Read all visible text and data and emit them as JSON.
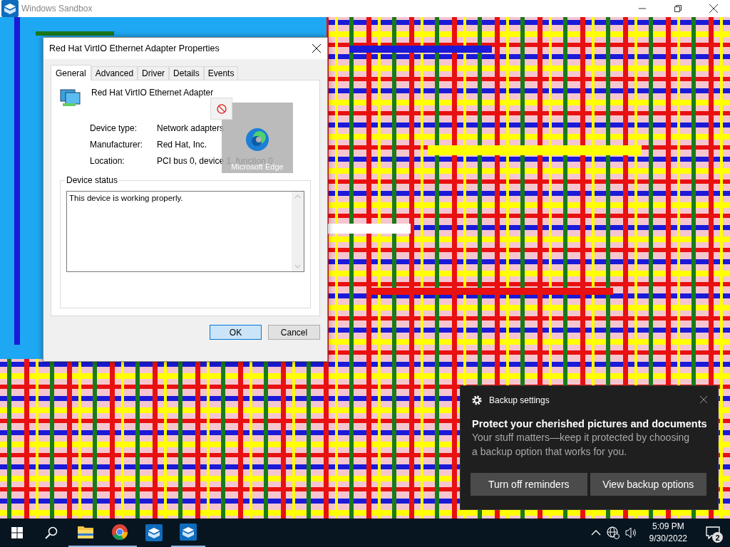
{
  "window": {
    "title": "Windows Sandbox"
  },
  "dialog": {
    "title": "Red Hat VirtIO Ethernet Adapter Properties",
    "tabs": [
      {
        "label": "General",
        "selected": true
      },
      {
        "label": "Advanced",
        "selected": false
      },
      {
        "label": "Driver",
        "selected": false
      },
      {
        "label": "Details",
        "selected": false
      },
      {
        "label": "Events",
        "selected": false
      }
    ],
    "device_name": "Red Hat VirtIO Ethernet Adapter",
    "properties": [
      {
        "label": "Device type:",
        "value": "Network adapters"
      },
      {
        "label": "Manufacturer:",
        "value": "Red Hat, Inc."
      },
      {
        "label": "Location:",
        "value": "PCI bus 0, device 1, function 0"
      }
    ],
    "status_group": "Device status",
    "status_text": "This device is working properly.",
    "buttons": [
      {
        "label": "OK",
        "default": true
      },
      {
        "label": "Cancel",
        "default": false
      }
    ]
  },
  "drag_preview": {
    "label": "Microsoft Edge"
  },
  "notification": {
    "app": "Backup settings",
    "title": "Protect your cherished pictures and documents",
    "body": "Your stuff matters—keep it protected by choosing a backup option that works for you.",
    "buttons": [
      "Turn off reminders",
      "View backup options"
    ]
  },
  "taskbar": {
    "apps": [
      {
        "kind": "folder",
        "running": true
      },
      {
        "kind": "chrome",
        "running": true
      },
      {
        "kind": "sandbox",
        "running": false
      },
      {
        "kind": "sandbox",
        "running": true
      }
    ],
    "time": "5:09 PM",
    "date": "9/30/2022",
    "notification_count": "2"
  }
}
